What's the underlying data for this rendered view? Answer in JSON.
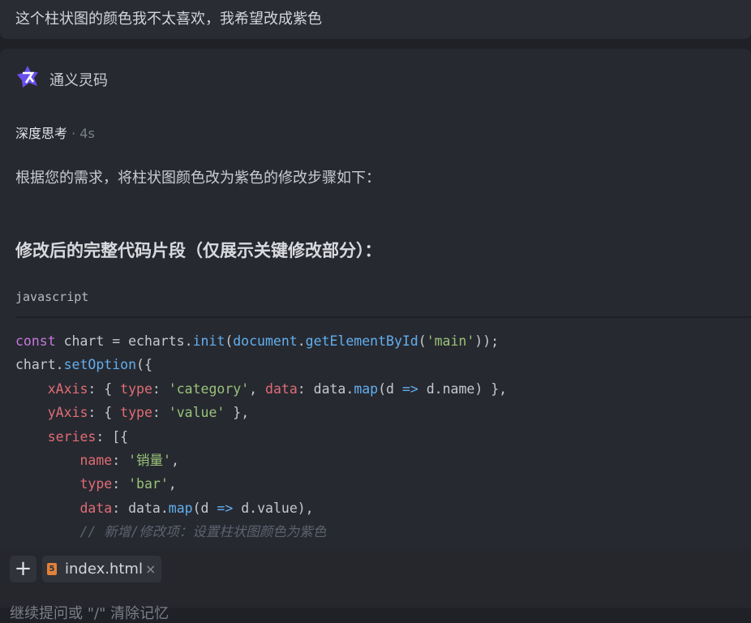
{
  "user_message": "这个柱状图的颜色我不太喜欢，我希望改成紫色",
  "assistant": {
    "name": "通义灵码",
    "thinking_label": "深度思考",
    "thinking_time": "· 4s",
    "intro": "根据您的需求，将柱状图颜色改为紫色的修改步骤如下：",
    "heading": "修改后的完整代码片段（仅展示关键修改部分）：",
    "code_language": "javascript"
  },
  "input": {
    "file_chip": "index.html",
    "placeholder": "继续提问或 \"/\" 清除记忆"
  },
  "colors": {
    "accent": "#4a7fe0",
    "keyword": "#c678dd",
    "property": "#e06c75",
    "string": "#98c379",
    "function": "#61afef"
  }
}
